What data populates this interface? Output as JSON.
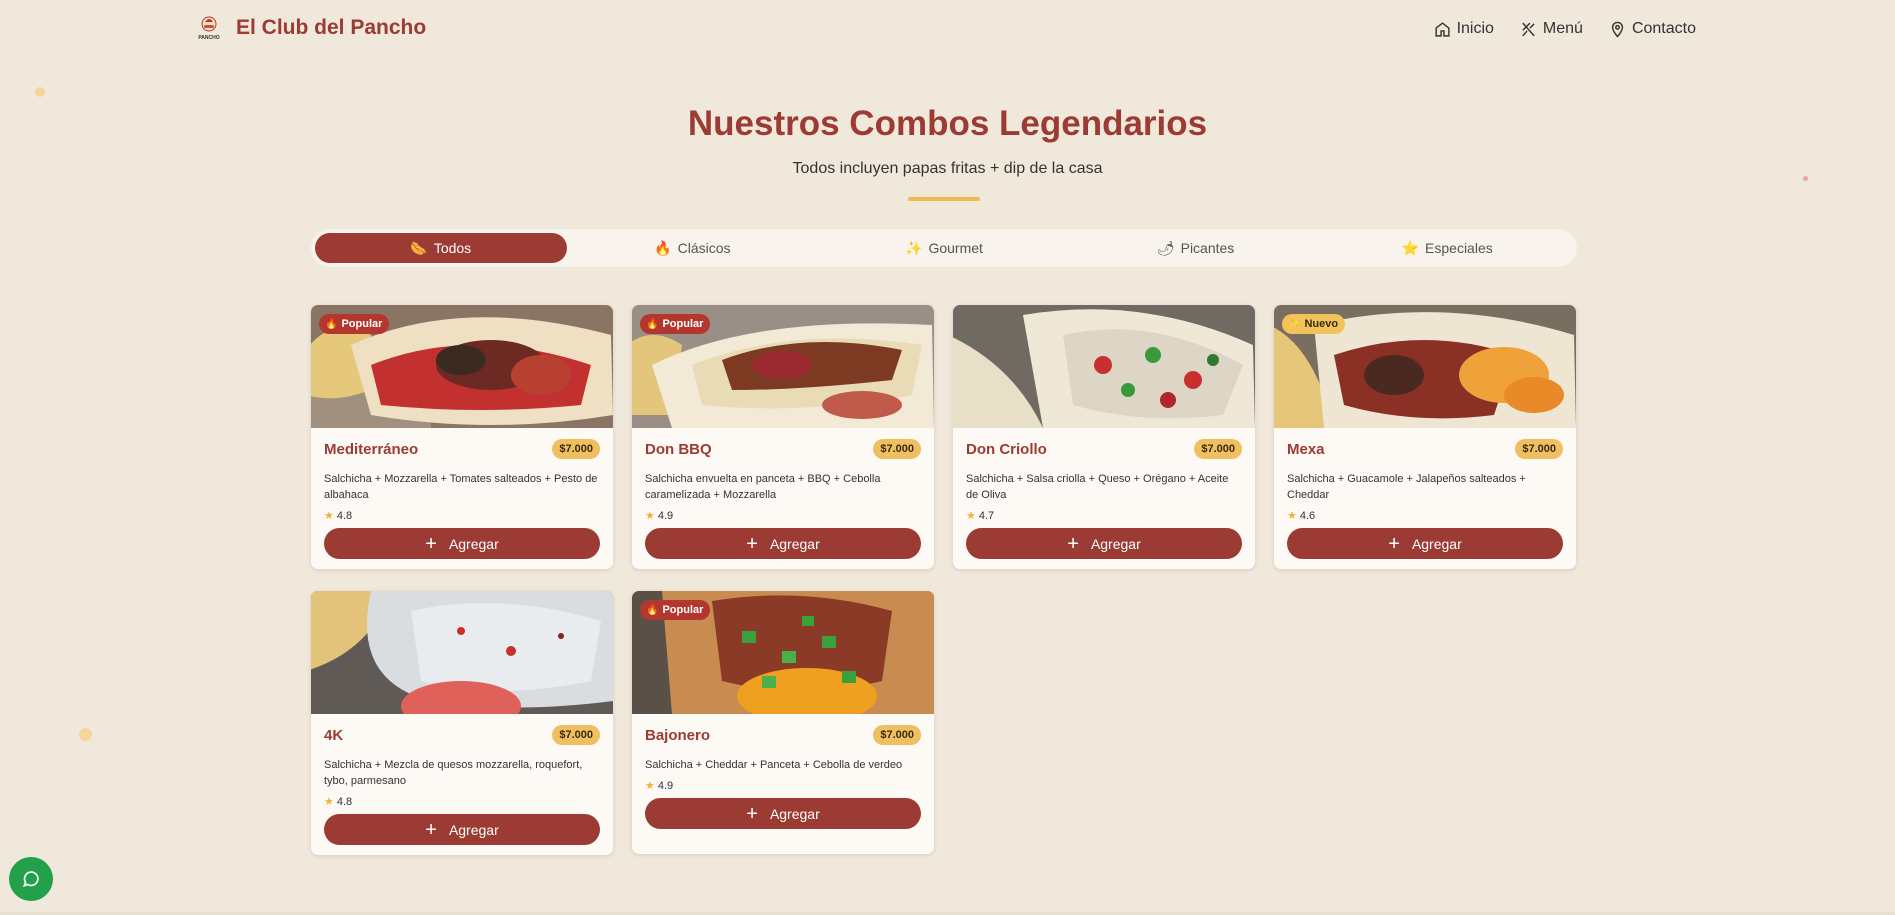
{
  "brand": {
    "name": "El Club del Pancho",
    "logo_text": "PANCHO"
  },
  "nav": [
    {
      "label": "Inicio",
      "icon": "home-icon"
    },
    {
      "label": "Menú",
      "icon": "utensils-icon"
    },
    {
      "label": "Contacto",
      "icon": "map-pin-icon"
    }
  ],
  "hero": {
    "title": "Nuestros Combos Legendarios",
    "subtitle": "Todos incluyen papas fritas + dip de la casa"
  },
  "tabs": [
    {
      "label": "Todos",
      "icon": "🌭",
      "active": true
    },
    {
      "label": "Clásicos",
      "icon": "🔥",
      "active": false
    },
    {
      "label": "Gourmet",
      "icon": "✨",
      "active": false
    },
    {
      "label": "Picantes",
      "icon": "🌶",
      "active": false
    },
    {
      "label": "Especiales",
      "icon": "⭐",
      "active": false
    }
  ],
  "add_label": "Agregar",
  "products": [
    {
      "name": "Mediterráneo",
      "price": "$7.000",
      "badge": "Popular",
      "badge_type": "popular",
      "desc": "Salchicha + Mozzarella + Tomates salteados + Pesto de albahaca",
      "rating": "4.8",
      "image": "hotdog-tomato-photo"
    },
    {
      "name": "Don BBQ",
      "price": "$7.000",
      "badge": "Popular",
      "badge_type": "popular",
      "desc": "Salchicha envuelta en panceta + BBQ + Cebolla caramelizada + Mozzarella",
      "rating": "4.9",
      "image": "hotdog-bbq-photo"
    },
    {
      "name": "Don Criollo",
      "price": "$7.000",
      "badge": "",
      "badge_type": "",
      "desc": "Salchicha + Salsa criolla + Queso + Orégano + Aceite de Oliva",
      "rating": "4.7",
      "image": "hotdog-criollo-photo"
    },
    {
      "name": "Mexa",
      "price": "$7.000",
      "badge": "Nuevo",
      "badge_type": "nuevo",
      "desc": "Salchicha + Guacamole + Jalapeños salteados + Cheddar",
      "rating": "4.6",
      "image": "hotdog-mexa-photo"
    },
    {
      "name": "4K",
      "price": "$7.000",
      "badge": "",
      "badge_type": "",
      "desc": "Salchicha + Mezcla de quesos mozzarella, roquefort, tybo, parmesano",
      "rating": "4.8",
      "image": "hotdog-cheese-photo"
    },
    {
      "name": "Bajonero",
      "price": "$7.000",
      "badge": "Popular",
      "badge_type": "popular",
      "desc": "Salchicha + Cheddar + Panceta + Cebolla de verdeo",
      "rating": "4.9",
      "image": "hotdog-bajonero-photo"
    }
  ],
  "colors": {
    "primary": "#9b3b33",
    "accent": "#f0c060",
    "background": "#f0e8da",
    "whatsapp": "#22a04b"
  }
}
